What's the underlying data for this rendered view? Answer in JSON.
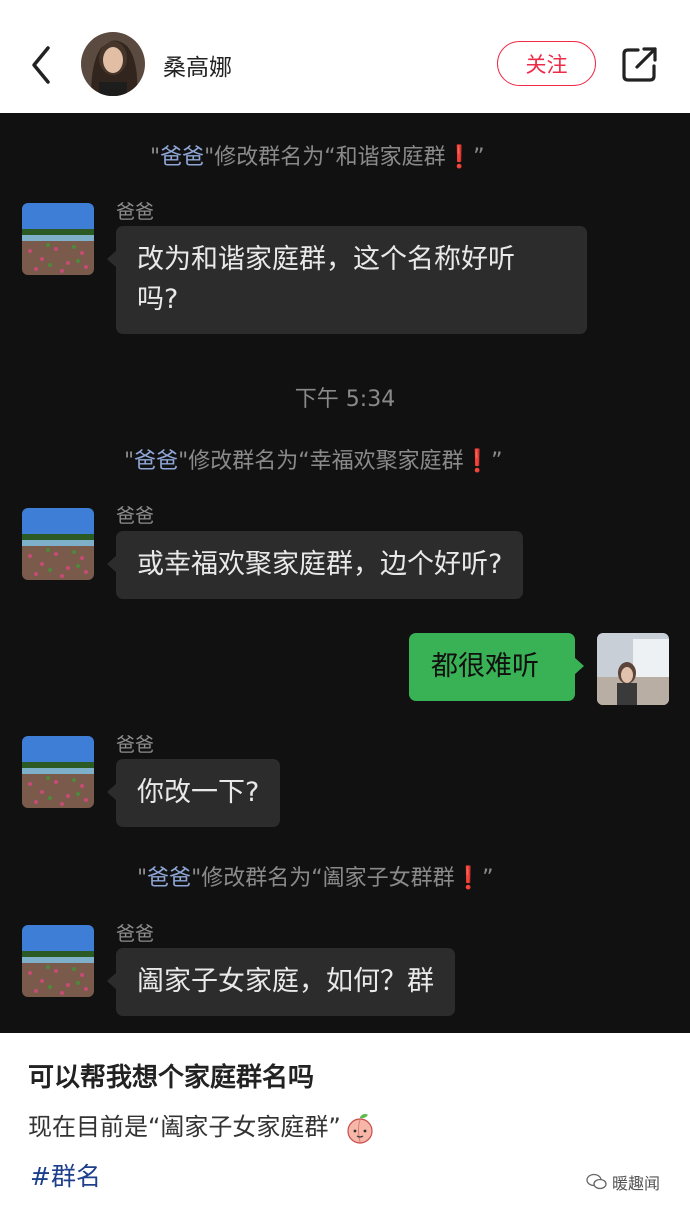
{
  "header": {
    "author_name": "桑高娜",
    "follow_label": "关注"
  },
  "chat": {
    "events": [
      {
        "type": "system",
        "name": "爸爸",
        "prefix": "\"",
        "middle": "\"修改群名为“",
        "group": "和谐家庭群",
        "suffix": "”"
      },
      {
        "type": "message",
        "sender": "爸爸",
        "text_line1": "改为和谐家庭群，这个名称好听",
        "text_line2": "吗?"
      },
      {
        "type": "time",
        "text": "下午 5:34"
      },
      {
        "type": "system",
        "name": "爸爸",
        "prefix": "\"",
        "middle": "\"修改群名为“",
        "group": "幸福欢聚家庭群",
        "suffix": "”"
      },
      {
        "type": "message",
        "sender": "爸爸",
        "text": "或幸福欢聚家庭群，边个好听?"
      },
      {
        "type": "mine",
        "text": "都很难听"
      },
      {
        "type": "message",
        "sender": "爸爸",
        "text": "你改一下?"
      },
      {
        "type": "system",
        "name": "爸爸",
        "prefix": "\"",
        "middle": "\"修改群名为“",
        "group": "阖家子女群群",
        "suffix": "”"
      },
      {
        "type": "message",
        "sender": "爸爸",
        "text": "阖家子女家庭，如何？群"
      }
    ],
    "bang_glyph": "❗"
  },
  "caption": {
    "title": "可以帮我想个家庭群名吗",
    "body": "现在目前是“阖家子女家庭群”",
    "hashtag": "#群名",
    "watermark": "暖趣闻"
  },
  "colors": {
    "follow_accent": "#ee2a48",
    "chat_bg": "#111111",
    "bubble_other": "#2c2c2c",
    "bubble_mine": "#39b155",
    "hashtag": "#1d3f8c"
  }
}
